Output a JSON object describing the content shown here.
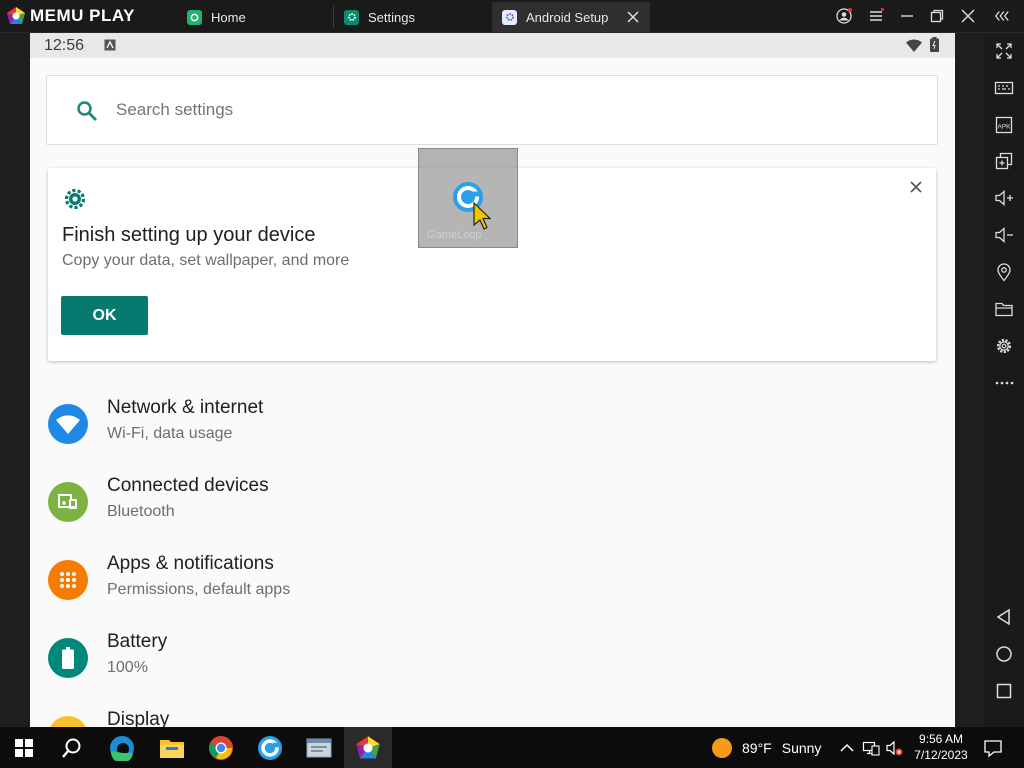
{
  "window": {
    "app_name": "MEMU PLAY",
    "tabs": [
      {
        "label": "Home"
      },
      {
        "label": "Settings"
      },
      {
        "label": "Android Setup"
      }
    ]
  },
  "android": {
    "status_time": "12:56",
    "search": {
      "placeholder": "Search settings"
    },
    "setup_card": {
      "title": "Finish setting up your device",
      "subtitle": "Copy your data, set wallpaper, and more",
      "ok_label": "OK"
    },
    "drag_ghost_label": "GameLoop",
    "items": [
      {
        "title": "Network & internet",
        "subtitle": "Wi-Fi, data usage",
        "color": "#1e88e5",
        "icon": "wifi-icon"
      },
      {
        "title": "Connected devices",
        "subtitle": "Bluetooth",
        "color": "#7cb342",
        "icon": "devices-icon"
      },
      {
        "title": "Apps & notifications",
        "subtitle": "Permissions, default apps",
        "color": "#f57c00",
        "icon": "apps-icon"
      },
      {
        "title": "Battery",
        "subtitle": "100%",
        "color": "#00897b",
        "icon": "battery-icon"
      },
      {
        "title": "Display",
        "subtitle": "",
        "color": "#fbc02d",
        "icon": "display-icon"
      }
    ]
  },
  "taskbar": {
    "weather_temp": "89°F",
    "weather_text": "Sunny",
    "time": "9:56 AM",
    "date": "7/12/2023"
  },
  "colors": {
    "accent": "#067a6e",
    "search_icon": "#1a8a78"
  }
}
